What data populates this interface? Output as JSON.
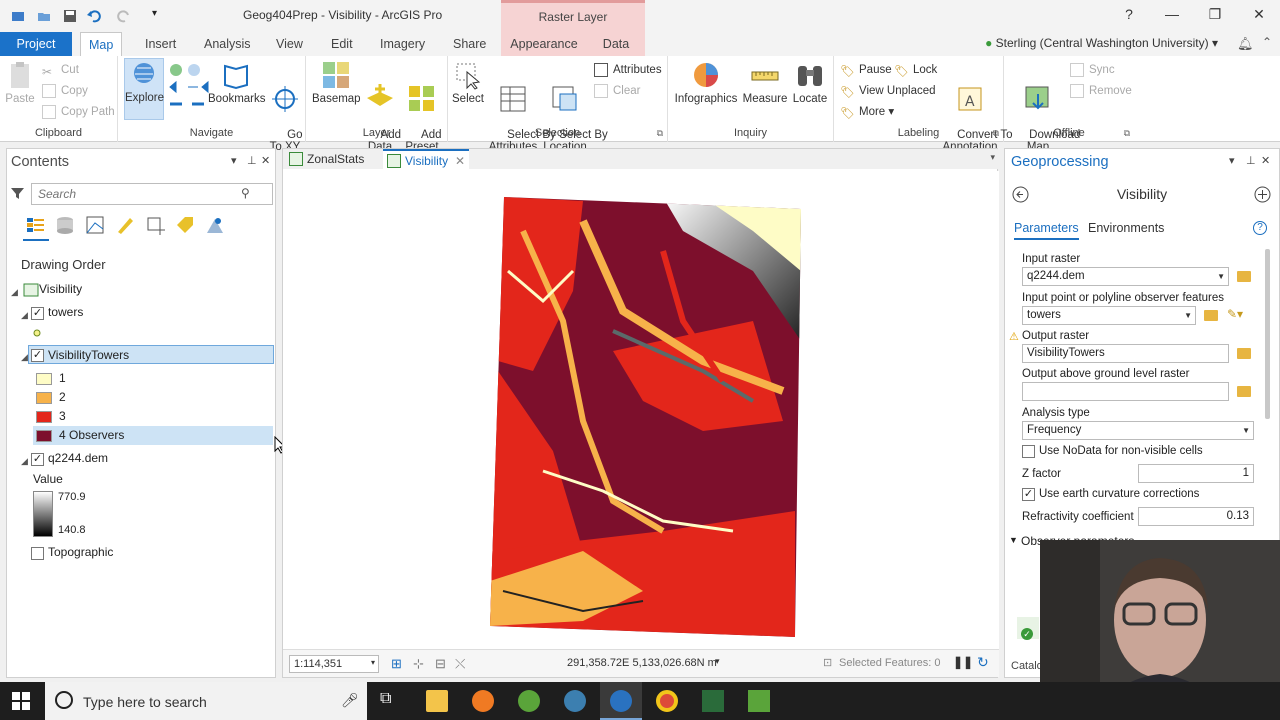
{
  "window": {
    "title": "Geog404Prep - Visibility - ArcGIS Pro",
    "context_tab_group": "Raster Layer",
    "user": "Sterling (Central Washington University)",
    "help": "?"
  },
  "tabs": [
    {
      "label": "Project"
    },
    {
      "label": "Map"
    },
    {
      "label": "Insert"
    },
    {
      "label": "Analysis"
    },
    {
      "label": "View"
    },
    {
      "label": "Edit"
    },
    {
      "label": "Imagery"
    },
    {
      "label": "Share"
    },
    {
      "label": "Appearance"
    },
    {
      "label": "Data"
    }
  ],
  "ribbon": {
    "clipboard": {
      "label": "Clipboard",
      "paste": "Paste",
      "cut": "Cut",
      "copy": "Copy",
      "copy_path": "Copy Path"
    },
    "navigate": {
      "label": "Navigate",
      "explore": "Explore",
      "bookmarks": "Bookmarks",
      "goto_xy": "Go\nTo XY"
    },
    "layer": {
      "label": "Layer",
      "basemap": "Basemap",
      "add_data": "Add\nData",
      "add_preset": "Add\nPreset"
    },
    "selection": {
      "label": "Selection",
      "select": "Select",
      "select_by_attributes": "Select By\nAttributes",
      "select_by_location": "Select By\nLocation",
      "attributes": "Attributes",
      "clear": "Clear"
    },
    "inquiry": {
      "label": "Inquiry",
      "infographics": "Infographics",
      "measure": "Measure",
      "locate": "Locate"
    },
    "labeling": {
      "label": "Labeling",
      "pause": "Pause",
      "lock": "Lock",
      "view_unplaced": "View Unplaced",
      "more": "More",
      "convert": "Convert To\nAnnotation"
    },
    "offline": {
      "label": "Offline",
      "download_map": "Download\nMap",
      "sync": "Sync",
      "remove": "Remove"
    }
  },
  "contents": {
    "title": "Contents",
    "search_placeholder": "Search",
    "drawing_order": "Drawing Order",
    "map_name": "Visibility",
    "layers": {
      "towers": "towers",
      "visibility_towers": "VisibilityTowers",
      "classes": [
        "1",
        "2",
        "3",
        "4 Observers"
      ],
      "class_colors": [
        "#fefcc6",
        "#f7b24a",
        "#e3261b",
        "#7d0f2c"
      ],
      "dem": "q2244.dem",
      "value_label": "Value",
      "value_max": "770.9",
      "value_min": "140.8",
      "topographic": "Topographic"
    }
  },
  "map": {
    "tabs": [
      "ZonalStats",
      "Visibility"
    ],
    "scale": "1:114,351",
    "coordinates": "291,358.72E 5,133,026.68N m",
    "selected_features": "Selected Features: 0"
  },
  "geoprocessing": {
    "title": "Geoprocessing",
    "tool": "Visibility",
    "tab_parameters": "Parameters",
    "tab_environments": "Environments",
    "input_raster_label": "Input raster",
    "input_raster": "q2244.dem",
    "observer_label": "Input point or polyline observer features",
    "observer": "towers",
    "output_raster_label": "Output raster",
    "output_raster": "VisibilityTowers",
    "agl_label": "Output above ground level raster",
    "agl_value": "",
    "analysis_type_label": "Analysis type",
    "analysis_type": "Frequency",
    "nodata_label": "Use NoData for non-visible cells",
    "z_factor_label": "Z factor",
    "z_factor": "1",
    "curvature_label": "Use earth curvature corrections",
    "refractivity_label": "Refractivity coefficient",
    "refractivity": "0.13",
    "observer_params": "Observer parameters",
    "catalog_partial": "Catalo"
  },
  "taskbar": {
    "search_placeholder": "Type here to search"
  }
}
